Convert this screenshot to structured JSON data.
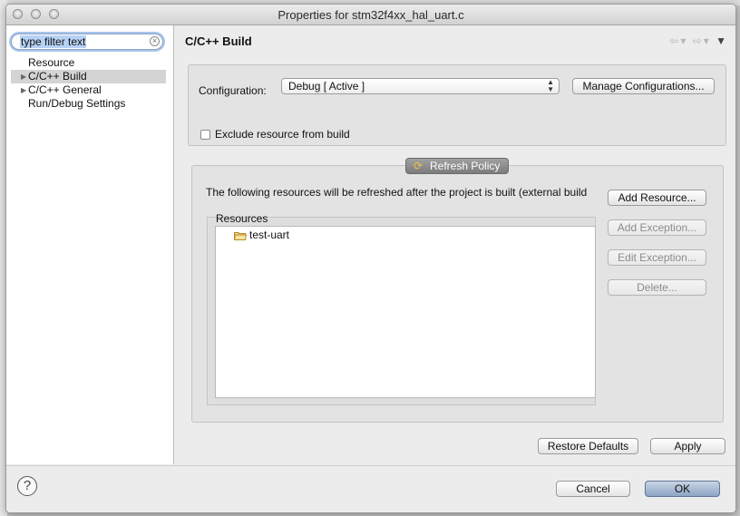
{
  "window": {
    "title": "Properties for stm32f4xx_hal_uart.c"
  },
  "sidebar": {
    "filter_placeholder": "type filter text",
    "items": [
      {
        "label": "Resource",
        "expandable": false,
        "selected": false
      },
      {
        "label": "C/C++ Build",
        "expandable": true,
        "selected": true
      },
      {
        "label": "C/C++ General",
        "expandable": true,
        "selected": false
      },
      {
        "label": "Run/Debug Settings",
        "expandable": false,
        "selected": false
      }
    ]
  },
  "page": {
    "title": "C/C++ Build",
    "configuration_label": "Configuration:",
    "configuration_value": "Debug  [ Active ]",
    "manage_configurations": "Manage Configurations...",
    "exclude_label": "Exclude resource from build",
    "exclude_checked": false,
    "refresh_policy_tab": "Refresh Policy",
    "refresh_description": "The following resources will be refreshed after the project is built (external build",
    "resources_label": "Resources",
    "resources": [
      {
        "name": "test-uart",
        "icon": "folder-icon"
      }
    ],
    "buttons": {
      "add_resource": "Add Resource...",
      "add_exception": "Add Exception...",
      "edit_exception": "Edit Exception...",
      "delete": "Delete..."
    },
    "restore_defaults": "Restore Defaults",
    "apply": "Apply"
  },
  "footer": {
    "help_icon": "?",
    "cancel": "Cancel",
    "ok": "OK"
  },
  "colors": {
    "accent": "#8da4c5",
    "selection": "#d4d4d4",
    "filter_highlight": "#b7d1f4"
  }
}
